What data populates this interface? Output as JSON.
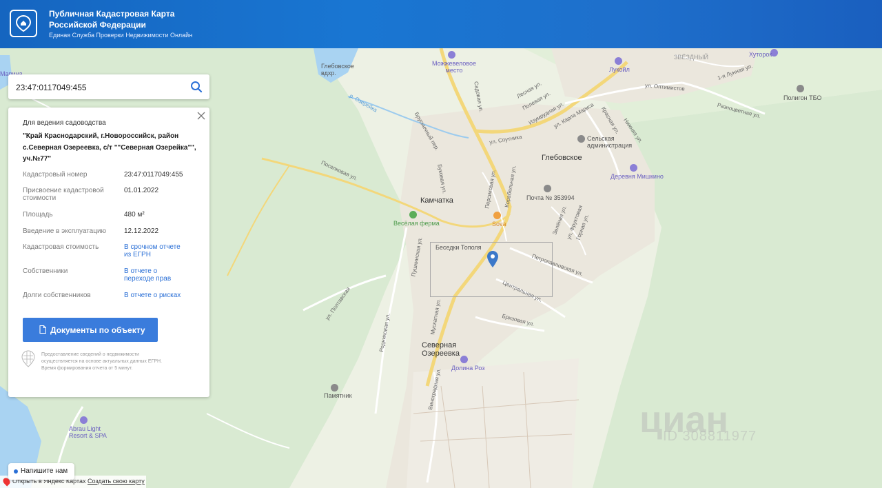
{
  "header": {
    "title": "Публичная Кадастровая Карта Российской Федерации",
    "subtitle": "Единая Служба Проверки Недвижимости Онлайн",
    "brand_color": "#1565c0"
  },
  "search": {
    "value": "23:47:0117049:455"
  },
  "panel": {
    "purpose": "Для ведения садоводства",
    "address": "\"Край Краснодарский, г.Новороссийск, район с.Северная Озереевка, с/т \"\"Северная Озерейка\"\", уч.№77\"",
    "rows": [
      {
        "label": "Кадастровый номер",
        "value": "23:47:0117049:455"
      },
      {
        "label": "Присвоение кадастровой стоимости",
        "value": "01.01.2022"
      },
      {
        "label": "Площадь",
        "value": "480 м²"
      },
      {
        "label": "Введение в эксплуатацию",
        "value": "12.12.2022"
      },
      {
        "label": "Кадастровая стоимость",
        "value": "В срочном отчете из ЕГРН"
      },
      {
        "label": "Собственники",
        "value": "В отчете о переходе прав"
      },
      {
        "label": "Долги собственников",
        "value": "В отчете о рисках"
      }
    ],
    "doc_button": "Документы по объекту",
    "disclaimer": "Предоставление сведений о недвижимости осуществляется на основе актуальных данных ЕГРН. Время формирования отчета от 5 минут.",
    "link_color": "#2a6fd6",
    "button_color": "#3a7cdc"
  },
  "map": {
    "labels": {
      "glebovskoe": "Глебовское",
      "kamchatka": "Камчатка",
      "severnaya": "Северная Озереевка",
      "vesyolaya": "Весёлая ферма",
      "sova": "Sova",
      "besedki": "Беседки Тополя",
      "pochta": "Почта № 353994",
      "selskaya": "Сельская администрация",
      "derevnya": "Деревня Мишкино",
      "mozhzhevelovoe": "Можжевеловое место",
      "lukoil": "Лукойл",
      "khutorok": "Хуторок",
      "poligon": "Полигон ТБО",
      "zvezdny": "ЗВЁЗДНЫЙ",
      "vdkhr": "Глебовское вдхр.",
      "dolina": "Долина Роз",
      "pamyatnik": "Памятник",
      "abrau": "Abrau Light Resort & SPA",
      "marina": "Марина",
      "ul_sputnika": "ул. Спутника",
      "ul_karla": "ул. Карла Маркса",
      "petropavl": "Петропавловская ул.",
      "centralnaya": "Центральная ул.",
      "brizovaya": "Бризовая ул.",
      "vinogradnaya": "Виноградная ул.",
      "muskatnaya": "Мускатная ул.",
      "rodnikovaya": "Родниковая ул.",
      "poselkovaya": "Поселковая ул.",
      "sadovaya": "Садовая ул.",
      "optimistov": "ул. Оптимистов",
      "raznocvetnaya": "Разноцветная ул.",
      "lunnaya": "1-я Лунная ул.",
      "lesnaya": "Лесная ул.",
      "polevaya": "Полевая ул.",
      "izumrudnaya": "Изумрудная ул.",
      "korabelnaya": "Корабельная ул.",
      "persikovaya": "Персиковая ул.",
      "bukovaya": "Буковая ул.",
      "zelenaya": "Зелёная ул.",
      "fruktovaya": "ул. Фруктовая",
      "gornaya": "Горная ул.",
      "krasnaya": "Красная ул.",
      "nizhnyaya": "Нижняя ул.",
      "brusnichny": "Брусничный пер.",
      "ul_pesh": "ул. Полтавская",
      "pushkinskaya": "Пушкинская ул.",
      "ozerka": "р. Озерейка"
    },
    "watermark": "циан",
    "watermark_id": "ID 308811977"
  },
  "chat": {
    "label": "Напишите нам"
  },
  "yandex": {
    "open_label": "Открыть в Яндекс Картах",
    "create_label": "Создать свою карту"
  }
}
